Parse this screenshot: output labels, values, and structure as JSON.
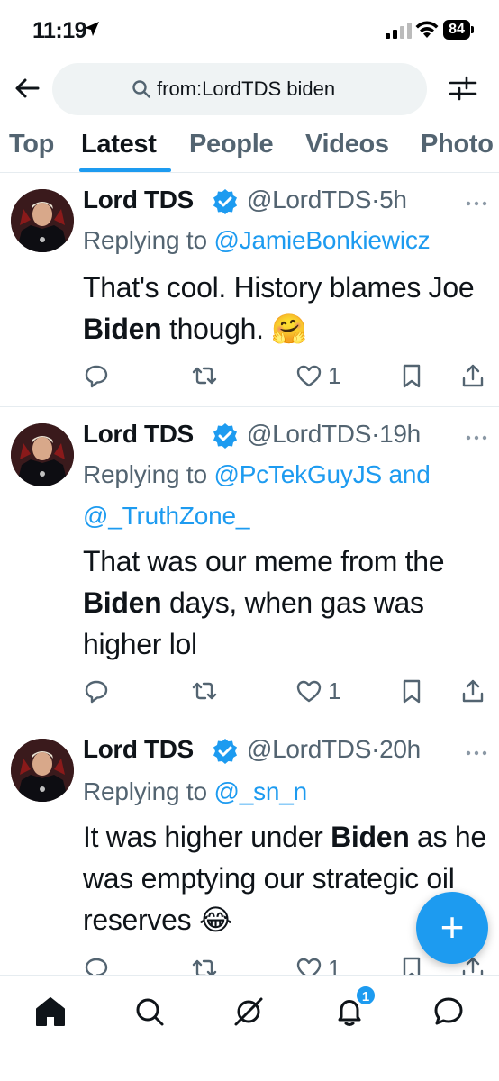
{
  "status": {
    "time": "11:19",
    "battery": "84"
  },
  "search": {
    "query": "from:LordTDS biden"
  },
  "tabs": [
    "Top",
    "Latest",
    "People",
    "Videos",
    "Photo"
  ],
  "tweets": [
    {
      "name": "Lord TDS",
      "handle": "@LordTDS·5h",
      "reply_prefix": "Replying to ",
      "mentions": [
        "@JamieBonkiewicz"
      ],
      "text_before": "That's cool. History blames Joe ",
      "bold": "Biden",
      "text_after": " though. 🤗",
      "likes": "1"
    },
    {
      "name": "Lord TDS",
      "handle": "@LordTDS·19h",
      "reply_prefix": "Replying to ",
      "mentions": [
        "@PcTekGuyJS",
        "@_TruthZone_"
      ],
      "mention_joiner": " and",
      "text_before": "That was our meme from the ",
      "bold": "Biden",
      "text_after": " days, when gas was higher lol",
      "likes": "1"
    },
    {
      "name": "Lord TDS",
      "handle": "@LordTDS·20h",
      "reply_prefix": "Replying to ",
      "mentions": [
        "@_sn_n"
      ],
      "text_before": "It was higher under ",
      "bold": "Biden",
      "text_after": " as he was emptying our strategic oil reserves 😂",
      "likes": "1"
    }
  ],
  "fab": {
    "label": "+"
  },
  "nav": {
    "notifications_badge": "1"
  },
  "colors": {
    "accent": "#1d9bf0",
    "text": "#0f1419",
    "secondary": "#536471"
  },
  "icons": [
    "back-arrow-icon",
    "search-icon",
    "filter-sliders-icon",
    "verified-badge-icon",
    "more-icon",
    "reply-icon",
    "retweet-icon",
    "like-icon",
    "bookmark-icon",
    "share-icon",
    "home-icon",
    "explore-icon",
    "grok-icon",
    "notifications-icon",
    "messages-icon"
  ]
}
